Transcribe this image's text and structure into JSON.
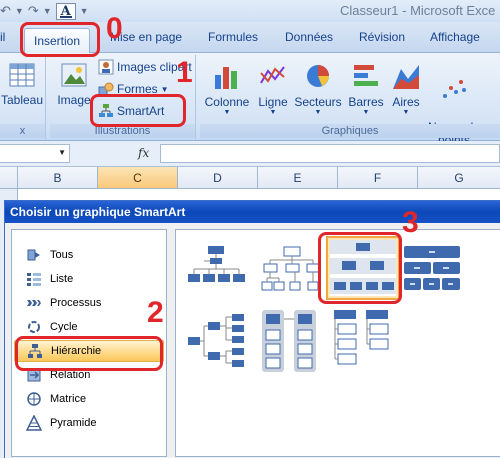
{
  "window": {
    "title": "Classeur1 - Microsoft Exce",
    "qat_font_glyph": "A"
  },
  "tabs": [
    "il",
    "Insertion",
    "Mise en page",
    "Formules",
    "Données",
    "Révision",
    "Affichage"
  ],
  "ribbon": {
    "tableau_label": "Tableau",
    "left_group_label": "x",
    "illustrations": {
      "image_label": "Image",
      "images_clipart_label": "Images clipart",
      "formes_label": "Formes",
      "smartart_label": "SmartArt",
      "group_label": "Illustrations"
    },
    "graphiques": {
      "buttons": [
        "Colonne",
        "Ligne",
        "Secteurs",
        "Barres",
        "Aires",
        "Nuage de\npoints"
      ],
      "group_label": "Graphiques"
    }
  },
  "formula_bar": {
    "fx_label": "fx",
    "value": ""
  },
  "sheet": {
    "columns": [
      "B",
      "C",
      "D",
      "E",
      "F",
      "G"
    ],
    "selected_column": "C"
  },
  "dialog": {
    "title": "Choisir un graphique SmartArt",
    "categories": [
      "Tous",
      "Liste",
      "Processus",
      "Cycle",
      "Hiérarchie",
      "Relation",
      "Matrice",
      "Pyramide"
    ],
    "selected_category": "Hiérarchie"
  },
  "annotations": {
    "step0": "0",
    "step1": "1",
    "step2": "2",
    "step3": "3",
    "color": "#e0262b"
  }
}
